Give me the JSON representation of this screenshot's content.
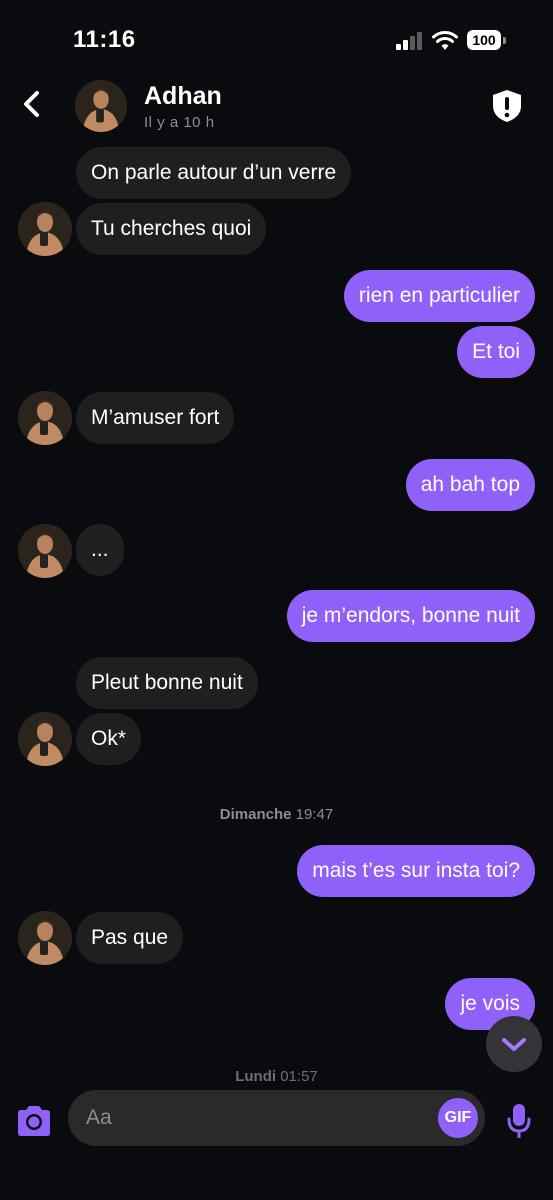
{
  "status_bar": {
    "time": "11:16",
    "battery": "100"
  },
  "header": {
    "name": "Adhan",
    "status": "Il y a 10 h"
  },
  "messages": [
    {
      "text": "On parle autour d’un verre"
    },
    {
      "text": "Tu cherches quoi"
    },
    {
      "text": "rien en particulier"
    },
    {
      "text": "Et toi"
    },
    {
      "text": "M’amuser fort"
    },
    {
      "text": "ah bah top"
    },
    {
      "text": "..."
    },
    {
      "text": "je m’endors, bonne nuit"
    },
    {
      "text": "Pleut bonne nuit"
    },
    {
      "text": "Ok*"
    },
    {
      "text": "mais t’es sur insta toi?"
    },
    {
      "text": "Pas que"
    },
    {
      "text": "je vois"
    }
  ],
  "date_separators": [
    {
      "day": "Dimanche",
      "time": "19:47"
    },
    {
      "day": "Lundi",
      "time": "01:57"
    }
  ],
  "composer": {
    "placeholder": "Aa",
    "gif_label": "GIF"
  },
  "colors": {
    "background": "#0a0b0e",
    "incoming_bubble": "#1f1f22",
    "outgoing_bubble": "#9061f9",
    "accent": "#9061f9"
  },
  "icons": [
    "back-chevron",
    "shield-alert",
    "camera",
    "gif",
    "microphone",
    "chevron-down"
  ]
}
